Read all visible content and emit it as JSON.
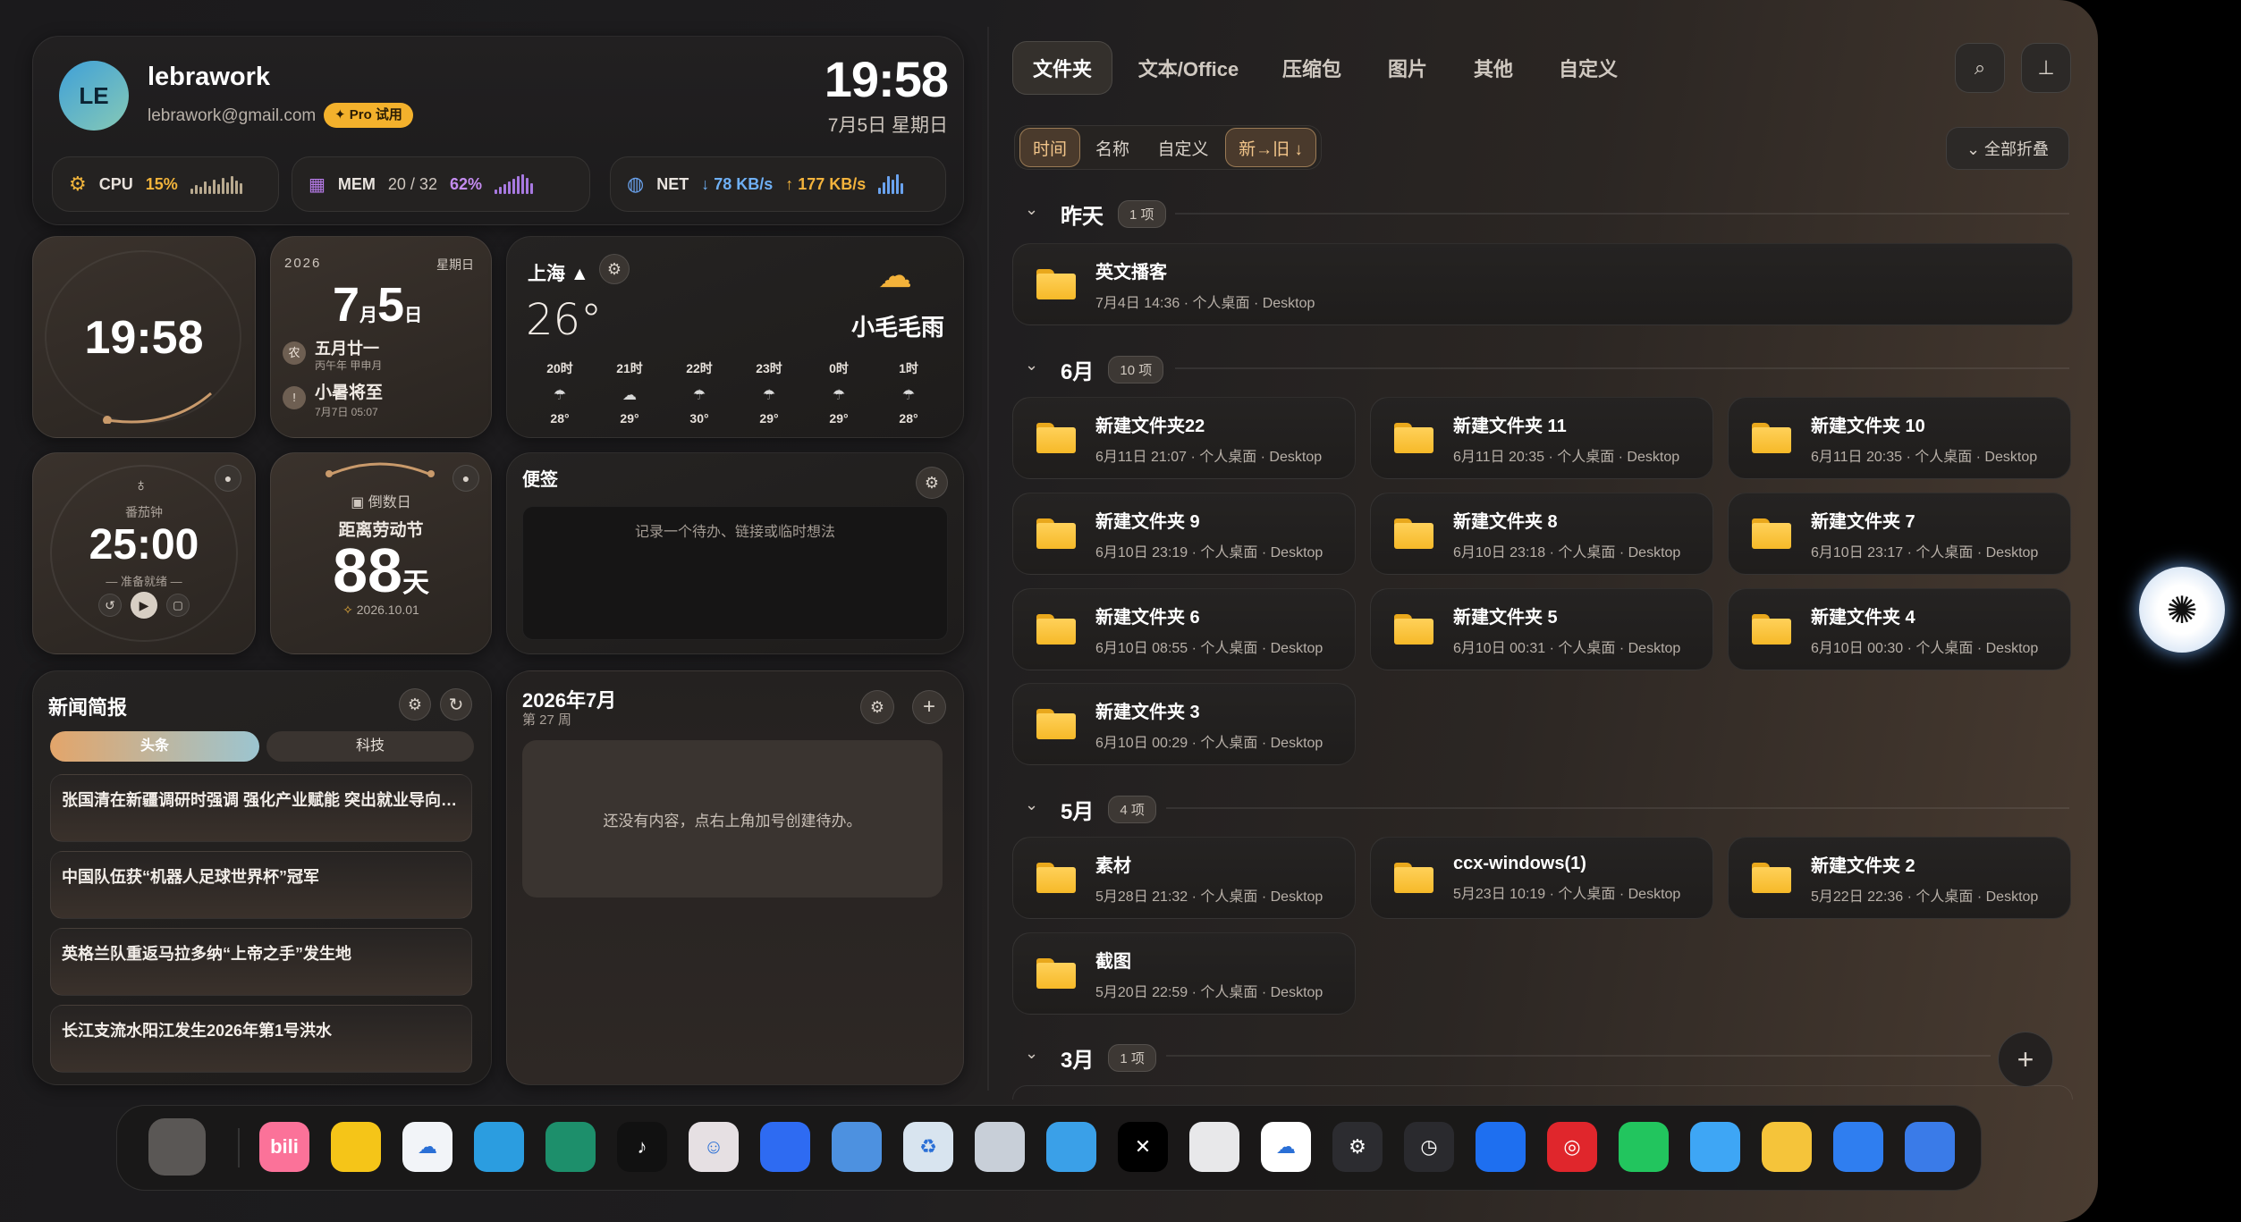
{
  "user": {
    "initials": "LE",
    "name": "lebrawork",
    "email": "lebrawork@gmail.com",
    "badge": "✦ Pro 试用"
  },
  "clock": {
    "time": "19:58",
    "date": "7月5日 星期日"
  },
  "system": {
    "cpu": {
      "label": "CPU",
      "value": "15%"
    },
    "mem": {
      "label": "MEM",
      "used": "20 / 32",
      "value": "62%"
    },
    "net": {
      "label": "NET",
      "down": "↓ 78 KB/s",
      "up": "↑ 177 KB/s"
    }
  },
  "widgets": {
    "analog_clock": {
      "time": "19:58"
    },
    "calendar": {
      "year": "2026",
      "weekday": "星期日",
      "month": "7",
      "month_unit": "月",
      "day": "5",
      "day_unit": "日",
      "lunar_badge": "农",
      "lunar": "五月廿一",
      "ganzhi": "丙午年 甲申月",
      "term_badge": "!",
      "term": "小暑将至",
      "term_time": "7月7日 05:07"
    },
    "weather": {
      "city": "上海 ▲",
      "temp": "26°",
      "condition": "小毛毛雨",
      "hours": [
        {
          "h": "20时",
          "icon": "☂",
          "t": "28°"
        },
        {
          "h": "21时",
          "icon": "☁",
          "t": "29°"
        },
        {
          "h": "22时",
          "icon": "☂",
          "t": "30°"
        },
        {
          "h": "23时",
          "icon": "☂",
          "t": "29°"
        },
        {
          "h": "0时",
          "icon": "☂",
          "t": "29°"
        },
        {
          "h": "1时",
          "icon": "☂",
          "t": "28°"
        }
      ]
    },
    "pomodoro": {
      "title": "番茄钟",
      "time": "25:00",
      "status": "— 准备就绪 —"
    },
    "countdown": {
      "title": "倒数日",
      "subtitle": "距离劳动节",
      "days": "88",
      "unit": "天",
      "date": "2026.10.01"
    },
    "notes": {
      "title": "便签",
      "placeholder": "记录一个待办、链接或临时想法"
    },
    "news": {
      "title": "新闻简报",
      "tabs": [
        "头条",
        "科技"
      ],
      "items": [
        "张国清在新疆调研时强调 强化产业赋能 突出就业导向 提升新疆经济发展质量",
        "中国队伍获“机器人足球世界杯”冠军",
        "英格兰队重返马拉多纳“上帝之手”发生地",
        "长江支流水阳江发生2026年第1号洪水"
      ]
    },
    "todo": {
      "title": "2026年7月",
      "week": "第 27 周",
      "empty": "还没有内容，点右上角加号创建待办。"
    }
  },
  "files": {
    "tabs": [
      "文件夹",
      "文本/Office",
      "压缩包",
      "图片",
      "其他",
      "自定义"
    ],
    "sort": [
      "时间",
      "名称",
      "自定义",
      "新→旧 ↓"
    ],
    "collapse_all": "⌄ 全部折叠",
    "groups": [
      {
        "label": "昨天",
        "count": "1 项",
        "items": [
          {
            "name": "英文播客",
            "meta": "7月4日 14:36 · 个人桌面 · Desktop"
          }
        ]
      },
      {
        "label": "6月",
        "count": "10 项",
        "items": [
          {
            "name": "新建文件夹22",
            "meta": "6月11日 21:07 · 个人桌面 · Desktop"
          },
          {
            "name": "新建文件夹 11",
            "meta": "6月11日 20:35 · 个人桌面 · Desktop"
          },
          {
            "name": "新建文件夹 10",
            "meta": "6月11日 20:35 · 个人桌面 · Desktop"
          },
          {
            "name": "新建文件夹 9",
            "meta": "6月10日 23:19 · 个人桌面 · Desktop"
          },
          {
            "name": "新建文件夹 8",
            "meta": "6月10日 23:18 · 个人桌面 · Desktop"
          },
          {
            "name": "新建文件夹 7",
            "meta": "6月10日 23:17 · 个人桌面 · Desktop"
          },
          {
            "name": "新建文件夹 6",
            "meta": "6月10日 08:55 · 个人桌面 · Desktop"
          },
          {
            "name": "新建文件夹 5",
            "meta": "6月10日 00:31 · 个人桌面 · Desktop"
          },
          {
            "name": "新建文件夹 4",
            "meta": "6月10日 00:30 · 个人桌面 · Desktop"
          },
          {
            "name": "新建文件夹 3",
            "meta": "6月10日 00:29 · 个人桌面 · Desktop"
          }
        ]
      },
      {
        "label": "5月",
        "count": "4 项",
        "items": [
          {
            "name": "素材",
            "meta": "5月28日 21:32 · 个人桌面 · Desktop"
          },
          {
            "name": "ccx-windows(1)",
            "meta": "5月23日 10:19 · 个人桌面 · Desktop"
          },
          {
            "name": "新建文件夹 2",
            "meta": "5月22日 22:36 · 个人桌面 · Desktop"
          },
          {
            "name": "截图",
            "meta": "5月20日 22:59 · 个人桌面 · Desktop"
          }
        ]
      },
      {
        "label": "3月",
        "count": "1 项",
        "items": []
      }
    ]
  },
  "dock": [
    {
      "name": "launcher",
      "glyph": "",
      "color": "#5a5755"
    },
    {
      "name": "bilibili",
      "glyph": "bili",
      "color": "#fb7299"
    },
    {
      "name": "sticky-notes",
      "glyph": "",
      "color": "#f5c518"
    },
    {
      "name": "cloud-drive",
      "glyph": "☁",
      "color": "#f2f4f8"
    },
    {
      "name": "monitor",
      "glyph": "",
      "color": "#2b9de0"
    },
    {
      "name": "clover-app",
      "glyph": "",
      "color": "#1d8f6b"
    },
    {
      "name": "tiktok",
      "glyph": "♪",
      "color": "#111111"
    },
    {
      "name": "avatar-app",
      "glyph": "☺",
      "color": "#e6e0e3"
    },
    {
      "name": "feishu",
      "glyph": "",
      "color": "#2e6bf2"
    },
    {
      "name": "paint",
      "glyph": "",
      "color": "#4d91e0"
    },
    {
      "name": "recycle-bin",
      "glyph": "♻",
      "color": "#d8e4ef"
    },
    {
      "name": "calculator",
      "glyph": "",
      "color": "#c8cfd8"
    },
    {
      "name": "notepad",
      "glyph": "",
      "color": "#3aa0e8"
    },
    {
      "name": "capcut",
      "glyph": "✕",
      "color": "#000000"
    },
    {
      "name": "snipping-tool",
      "glyph": "",
      "color": "#e8e8ea"
    },
    {
      "name": "baidu-netdisk",
      "glyph": "☁",
      "color": "#ffffff"
    },
    {
      "name": "settings",
      "glyph": "⚙",
      "color": "#2c2c30"
    },
    {
      "name": "clock-app",
      "glyph": "◷",
      "color": "#2a2a2e"
    },
    {
      "name": "lark-app",
      "glyph": "",
      "color": "#1e6ff0"
    },
    {
      "name": "netease-music",
      "glyph": "◎",
      "color": "#e0262c"
    },
    {
      "name": "wechat",
      "glyph": "",
      "color": "#22c55e"
    },
    {
      "name": "finder",
      "glyph": "",
      "color": "#3ea6f5"
    },
    {
      "name": "file-explorer",
      "glyph": "",
      "color": "#f5c43a"
    },
    {
      "name": "bird-app",
      "glyph": "",
      "color": "#2f7ef0"
    },
    {
      "name": "photos",
      "glyph": "",
      "color": "#3a7be8"
    }
  ]
}
